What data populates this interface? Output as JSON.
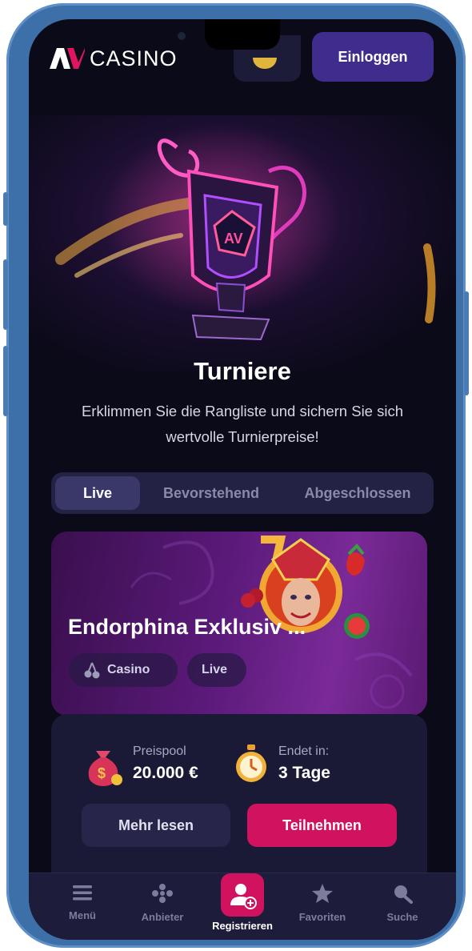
{
  "header": {
    "logo_text": "CASINO",
    "login_label": "Einloggen"
  },
  "hero": {
    "title": "Turniere",
    "subtitle": "Erklimmen Sie die Rangliste und sichern Sie sich wertvolle Turnierpreise!"
  },
  "tabs": [
    {
      "label": "Live",
      "active": true
    },
    {
      "label": "Bevorstehend",
      "active": false
    },
    {
      "label": "Abgeschlossen",
      "active": false
    }
  ],
  "tournament": {
    "name": "Endorphina Exklusiv ...",
    "chips": [
      {
        "label": "Casino",
        "icon": "cherry-icon"
      },
      {
        "label": "Live",
        "icon": ""
      }
    ],
    "prize_label": "Preispool",
    "prize_value": "20.000 €",
    "ends_label": "Endet in:",
    "ends_value": "3 Tage",
    "more_label": "Mehr lesen",
    "join_label": "Teilnehmen"
  },
  "nav": [
    {
      "label": "Menü",
      "icon": "menu-icon"
    },
    {
      "label": "Anbieter",
      "icon": "providers-icon"
    },
    {
      "label": "Registrieren",
      "icon": "add-user-icon"
    },
    {
      "label": "Favoriten",
      "icon": "star-icon"
    },
    {
      "label": "Suche",
      "icon": "search-icon"
    }
  ],
  "colors": {
    "accent": "#d1125e",
    "login_bg": "#3f2c8c",
    "background": "#0b0a18"
  }
}
